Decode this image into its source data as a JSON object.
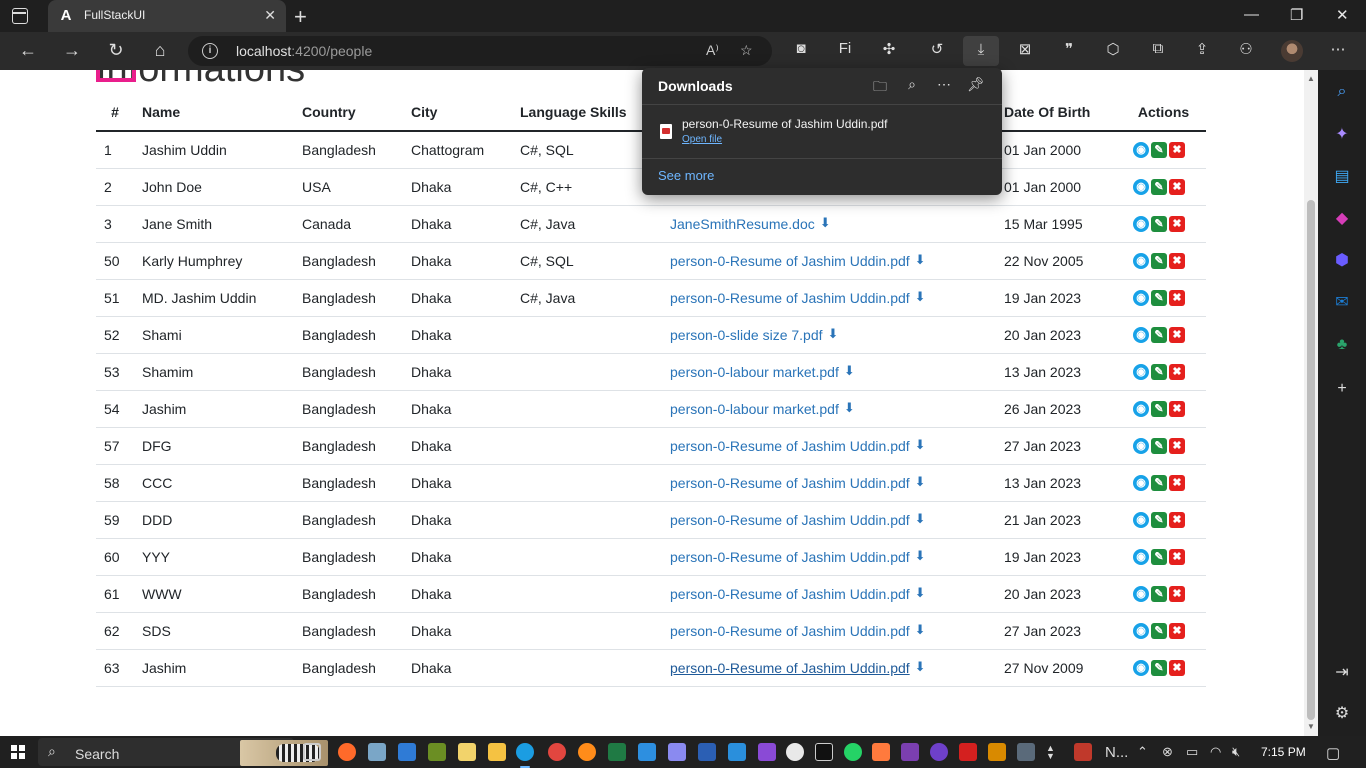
{
  "browser": {
    "tab_title": "FullStackUI",
    "tab_favicon": "A",
    "url_host": "localhost",
    "url_rest": ":4200/people"
  },
  "page": {
    "heading": "Informations",
    "columns": {
      "num": "#",
      "name": "Name",
      "country": "Country",
      "city": "City",
      "language": "Language Skills",
      "dob": "Date Of Birth",
      "actions": "Actions"
    },
    "rows": [
      {
        "id": "1",
        "name": "Jashim Uddin",
        "country": "Bangladesh",
        "city": "Chattogram",
        "languages": "C#, SQL",
        "file": "",
        "dob": "01 Jan 2000"
      },
      {
        "id": "2",
        "name": "John Doe",
        "country": "USA",
        "city": "Dhaka",
        "languages": "C#, C++",
        "file": "",
        "dob": "01 Jan 2000"
      },
      {
        "id": "3",
        "name": "Jane Smith",
        "country": "Canada",
        "city": "Dhaka",
        "languages": "C#, Java",
        "file": "JaneSmithResume.doc",
        "dob": "15 Mar 1995"
      },
      {
        "id": "50",
        "name": "Karly Humphrey",
        "country": "Bangladesh",
        "city": "Dhaka",
        "languages": "C#, SQL",
        "file": "person-0-Resume of Jashim Uddin.pdf",
        "dob": "22 Nov 2005"
      },
      {
        "id": "51",
        "name": "MD. Jashim Uddin",
        "country": "Bangladesh",
        "city": "Dhaka",
        "languages": "C#, Java",
        "file": "person-0-Resume of Jashim Uddin.pdf",
        "dob": "19 Jan 2023"
      },
      {
        "id": "52",
        "name": "Shami",
        "country": "Bangladesh",
        "city": "Dhaka",
        "languages": "",
        "file": "person-0-slide size 7.pdf",
        "dob": "20 Jan 2023"
      },
      {
        "id": "53",
        "name": "Shamim",
        "country": "Bangladesh",
        "city": "Dhaka",
        "languages": "",
        "file": "person-0-labour market.pdf",
        "dob": "13 Jan 2023"
      },
      {
        "id": "54",
        "name": "Jashim",
        "country": "Bangladesh",
        "city": "Dhaka",
        "languages": "",
        "file": "person-0-labour market.pdf",
        "dob": "26 Jan 2023"
      },
      {
        "id": "57",
        "name": "DFG",
        "country": "Bangladesh",
        "city": "Dhaka",
        "languages": "",
        "file": "person-0-Resume of Jashim Uddin.pdf",
        "dob": "27 Jan 2023"
      },
      {
        "id": "58",
        "name": "CCC",
        "country": "Bangladesh",
        "city": "Dhaka",
        "languages": "",
        "file": "person-0-Resume of Jashim Uddin.pdf",
        "dob": "13 Jan 2023"
      },
      {
        "id": "59",
        "name": "DDD",
        "country": "Bangladesh",
        "city": "Dhaka",
        "languages": "",
        "file": "person-0-Resume of Jashim Uddin.pdf",
        "dob": "21 Jan 2023"
      },
      {
        "id": "60",
        "name": "YYY",
        "country": "Bangladesh",
        "city": "Dhaka",
        "languages": "",
        "file": "person-0-Resume of Jashim Uddin.pdf",
        "dob": "19 Jan 2023"
      },
      {
        "id": "61",
        "name": "WWW",
        "country": "Bangladesh",
        "city": "Dhaka",
        "languages": "",
        "file": "person-0-Resume of Jashim Uddin.pdf",
        "dob": "20 Jan 2023"
      },
      {
        "id": "62",
        "name": "SDS",
        "country": "Bangladesh",
        "city": "Dhaka",
        "languages": "",
        "file": "person-0-Resume of Jashim Uddin.pdf",
        "dob": "27 Jan 2023"
      },
      {
        "id": "63",
        "name": "Jashim",
        "country": "Bangladesh",
        "city": "Dhaka",
        "languages": "",
        "file": "person-0-Resume of Jashim Uddin.pdf",
        "dob": "27 Nov 2009"
      }
    ]
  },
  "downloads": {
    "title": "Downloads",
    "file_name": "person-0-Resume of Jashim Uddin.pdf",
    "open_file": "Open file",
    "see_more": "See more"
  },
  "taskbar": {
    "search_label": "Search",
    "app_label": "N...",
    "time": "7:15 PM"
  },
  "colors": {
    "link": "#2a74b8",
    "view": "#17a2e8",
    "edit": "#1e8e3e",
    "delete": "#e5201d",
    "heading_accent": "#e91e8c"
  }
}
